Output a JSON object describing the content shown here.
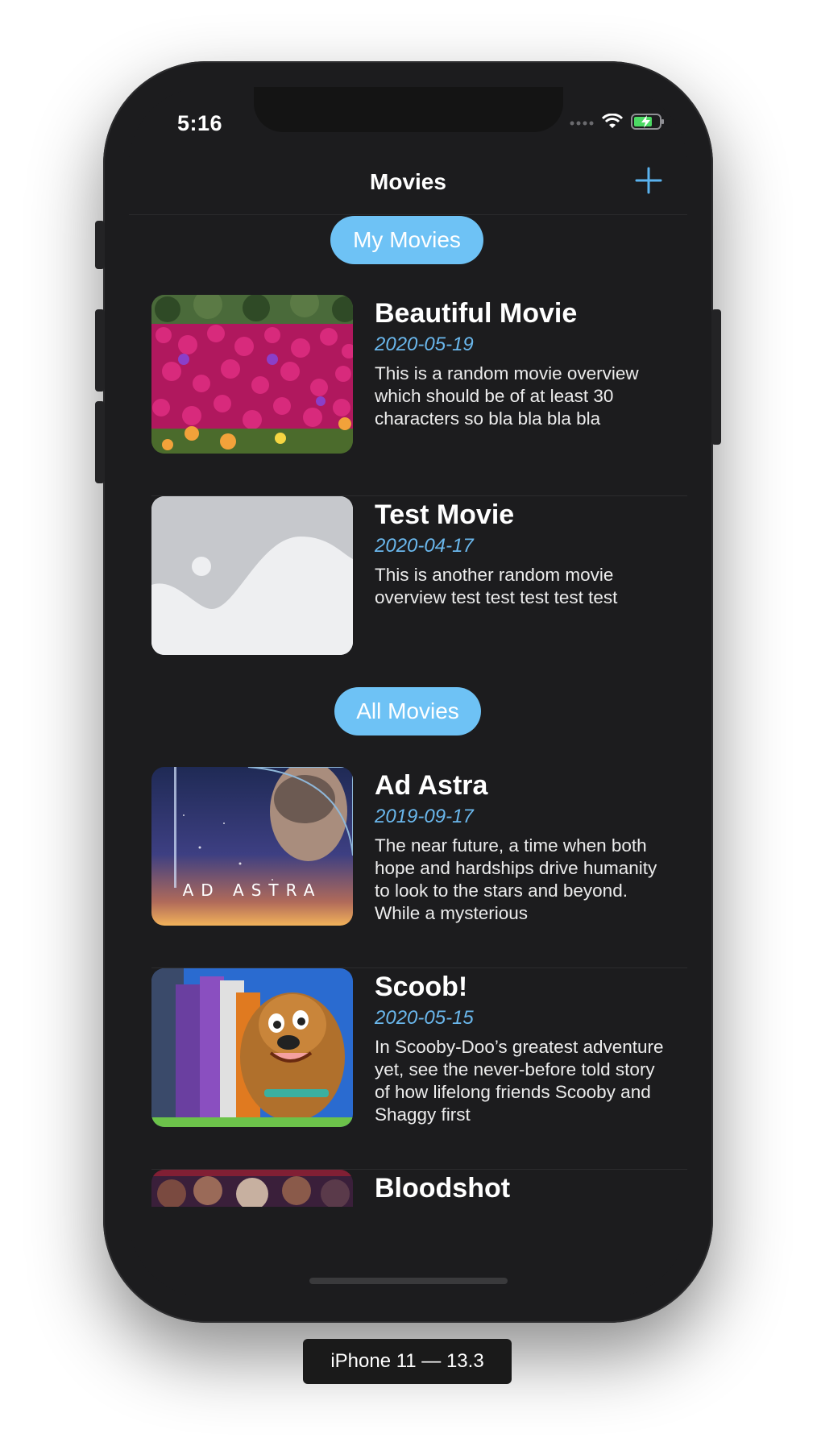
{
  "status_bar": {
    "time": "5:16"
  },
  "nav": {
    "title": "Movies",
    "add_icon": "plus-icon"
  },
  "sections": {
    "my_movies": "My Movies",
    "all_movies": "All Movies"
  },
  "my_movies": [
    {
      "title": "Beautiful Movie",
      "date": "2020-05-19",
      "overview": "This is a random movie overview which should be of at least 30 characters so bla bla bla bla",
      "image": "flowers"
    },
    {
      "title": "Test Movie",
      "date": "2020-04-17",
      "overview": "This is another random movie overview test test test test test",
      "image": "placeholder-image-icon"
    }
  ],
  "all_movies": [
    {
      "title": "Ad Astra",
      "date": "2019-09-17",
      "overview": "The near future, a time when both hope and hardships drive humanity to look to the stars and beyond. While a mysterious",
      "image": "ad-astra-poster",
      "poster_text": "AD ASTRA"
    },
    {
      "title": "Scoob!",
      "date": "2020-05-15",
      "overview": "In Scooby-Doo’s greatest adventure yet, see the never-before told story of how lifelong friends Scooby and Shaggy first",
      "image": "scoob-poster"
    },
    {
      "title": "Bloodshot",
      "image": "bloodshot-poster"
    }
  ],
  "simulator_label": "iPhone 11 — 13.3",
  "colors": {
    "background": "#1c1c1e",
    "accent": "#6ec2f5",
    "date": "#6ab7ec"
  }
}
